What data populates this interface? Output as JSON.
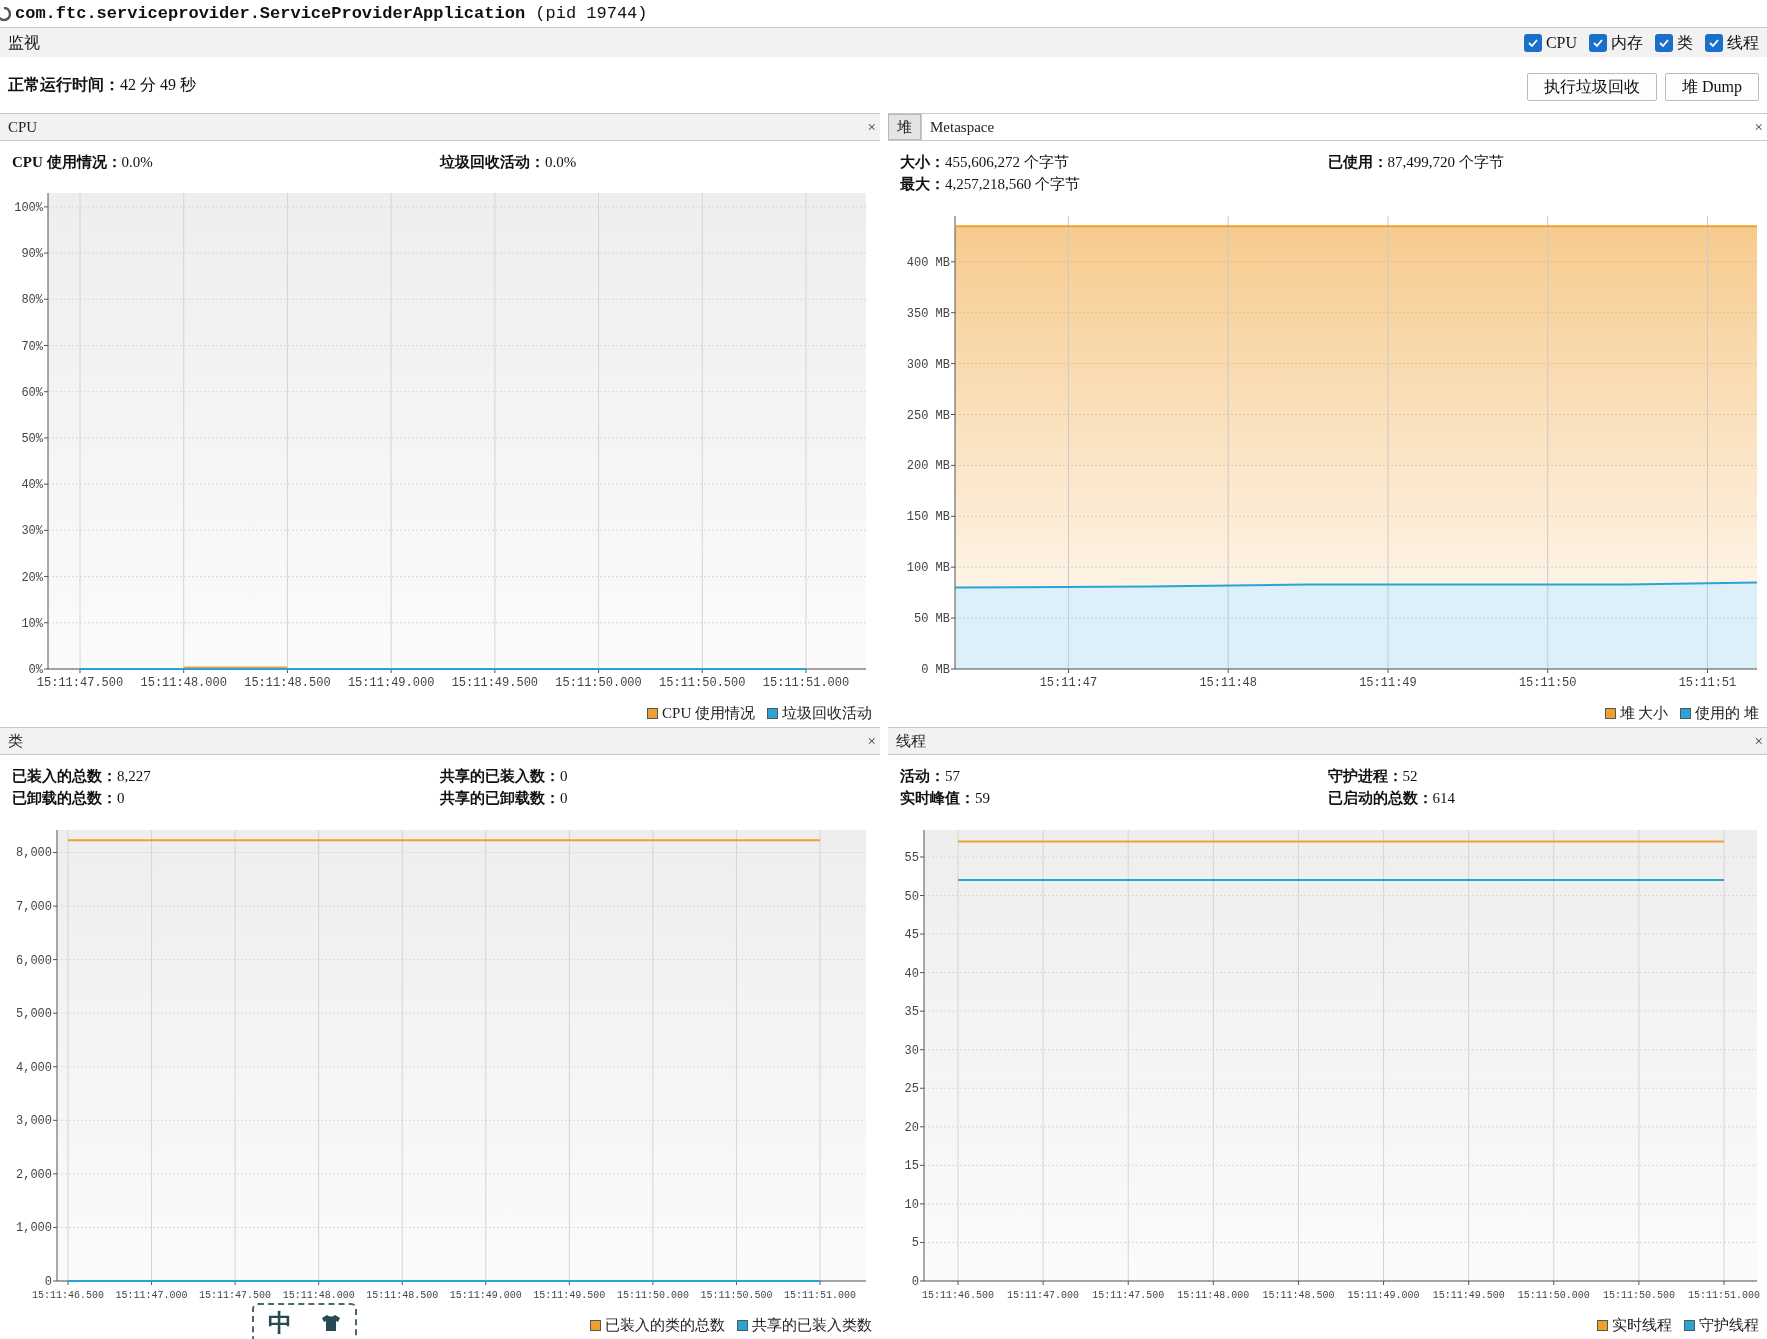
{
  "window": {
    "title": "**com.ftc.serviceprovider.ServiceProviderApplication** (pid 19744)"
  },
  "section": {
    "title": "监视",
    "toggles": [
      {
        "label": "CPU",
        "checked": true
      },
      {
        "label": "内存",
        "checked": true
      },
      {
        "label": "类",
        "checked": true
      },
      {
        "label": "线程",
        "checked": true
      }
    ]
  },
  "uptime": "**正常运行时间：**42 分 49 秒",
  "buttons": [
    "执行垃圾回收",
    "堆 Dump"
  ],
  "panels": [
    {
      "title": "CPU",
      "close": "×",
      "stats": [
        "**CPU 使用情况：**0.0%",
        "**垃圾回收活动：**0.0%"
      ],
      "chart_data": {
        "type": "line",
        "grid": true,
        "ylim": [
          0,
          103
        ],
        "categories": [
          "15:11:47.500",
          "15:11:48.000",
          "15:11:48.500",
          "15:11:49.000",
          "15:11:49.500",
          "15:11:50.000",
          "15:11:50.500",
          "15:11:51.000"
        ],
        "yticks": [
          {
            "value": 0,
            "label": "0%"
          },
          {
            "value": 10,
            "label": "10%"
          },
          {
            "value": 20,
            "label": "20%"
          },
          {
            "value": 30,
            "label": "30%"
          },
          {
            "value": 40,
            "label": "40%"
          },
          {
            "value": 50,
            "label": "50%"
          },
          {
            "value": 60,
            "label": "60%"
          },
          {
            "value": 70,
            "label": "70%"
          },
          {
            "value": 80,
            "label": "80%"
          },
          {
            "value": 90,
            "label": "90%"
          },
          {
            "value": 100,
            "label": "100%"
          }
        ],
        "series": [
          {
            "name": "CPU 使用情况",
            "color": "#f0a030",
            "values": [
              null,
              0.3,
              0.3,
              null,
              null,
              null,
              null,
              null
            ]
          },
          {
            "name": "垃圾回收活动",
            "color": "#2aa4d4",
            "values": [
              0,
              0,
              0,
              0,
              0,
              0,
              0,
              0
            ]
          }
        ]
      }
    },
    {
      "tabs": [
        {
          "label": "堆",
          "selected": true
        },
        {
          "label": "Metaspace",
          "selected": false
        }
      ],
      "close": "×",
      "stats": [
        "**大小：**455,606,272 个字节",
        "**已使用：**87,499,720 个字节",
        "**最大：**4,257,218,560 个字节"
      ],
      "chart_data": {
        "type": "area",
        "grid": true,
        "x": [
          54706.29,
          54707.5,
          54708.5,
          54709.5,
          54710.5,
          54711.31
        ],
        "xlim": [
          54706.29,
          54711.31
        ],
        "ylim": [
          0,
          445
        ],
        "xticks": [
          {
            "value": 54707,
            "label": "15:11:47"
          },
          {
            "value": 54708,
            "label": "15:11:48"
          },
          {
            "value": 54709,
            "label": "15:11:49"
          },
          {
            "value": 54710,
            "label": "15:11:50"
          },
          {
            "value": 54711,
            "label": "15:11:51"
          }
        ],
        "yticks": [
          {
            "value": 0,
            "label": "0 MB"
          },
          {
            "value": 50,
            "label": "50 MB"
          },
          {
            "value": 100,
            "label": "100 MB"
          },
          {
            "value": 150,
            "label": "150 MB"
          },
          {
            "value": 200,
            "label": "200 MB"
          },
          {
            "value": 250,
            "label": "250 MB"
          },
          {
            "value": 300,
            "label": "300 MB"
          },
          {
            "value": 350,
            "label": "350 MB"
          },
          {
            "value": 400,
            "label": "400 MB"
          }
        ],
        "series": [
          {
            "name": "堆 大小",
            "type": "area",
            "color": "#f0a030",
            "values": [
              435,
              435,
              435,
              435,
              435,
              435
            ]
          },
          {
            "name": "使用的 堆",
            "type": "area",
            "color": "#2aa4d4",
            "values": [
              80,
              81,
              83,
              83,
              83,
              85
            ]
          }
        ]
      }
    },
    {
      "title": "类",
      "close": "×",
      "stats": [
        "**已装入的总数：**8,227",
        "**共享的已装入数：**0",
        "**已卸载的总数：**0",
        "**共享的已卸载数：**0"
      ],
      "chart_data": {
        "type": "line",
        "grid": true,
        "ylim": [
          0,
          8420
        ],
        "categories": [
          "15:11:46.500",
          "15:11:47.000",
          "15:11:47.500",
          "15:11:48.000",
          "15:11:48.500",
          "15:11:49.000",
          "15:11:49.500",
          "15:11:50.000",
          "15:11:50.500",
          "15:11:51.000"
        ],
        "yticks": [
          {
            "value": 0,
            "label": "0"
          },
          {
            "value": 1000,
            "label": "1,000"
          },
          {
            "value": 2000,
            "label": "2,000"
          },
          {
            "value": 3000,
            "label": "3,000"
          },
          {
            "value": 4000,
            "label": "4,000"
          },
          {
            "value": 5000,
            "label": "5,000"
          },
          {
            "value": 6000,
            "label": "6,000"
          },
          {
            "value": 7000,
            "label": "7,000"
          },
          {
            "value": 8000,
            "label": "8,000"
          }
        ],
        "series": [
          {
            "name": "已装入的类的总数",
            "color": "#f0a030",
            "values": [
              8230,
              8230,
              8230,
              8230,
              8230,
              8230,
              8230,
              8230,
              8230,
              8230
            ]
          },
          {
            "name": "共享的已装入类数",
            "color": "#2aa4d4",
            "values": [
              0,
              0,
              0,
              0,
              0,
              0,
              0,
              0,
              0,
              0
            ]
          }
        ]
      }
    },
    {
      "title": "线程",
      "close": "×",
      "stats": [
        "**活动：**57",
        "**守护进程：**52",
        "**实时峰值：**59",
        "**已启动的总数：**614"
      ],
      "chart_data": {
        "type": "line",
        "grid": true,
        "ylim": [
          0,
          58.5
        ],
        "categories": [
          "15:11:46.500",
          "15:11:47.000",
          "15:11:47.500",
          "15:11:48.000",
          "15:11:48.500",
          "15:11:49.000",
          "15:11:49.500",
          "15:11:50.000",
          "15:11:50.500",
          "15:11:51.000"
        ],
        "yticks": [
          {
            "value": 0,
            "label": "0"
          },
          {
            "value": 5,
            "label": "5"
          },
          {
            "value": 10,
            "label": "10"
          },
          {
            "value": 15,
            "label": "15"
          },
          {
            "value": 20,
            "label": "20"
          },
          {
            "value": 25,
            "label": "25"
          },
          {
            "value": 30,
            "label": "30"
          },
          {
            "value": 35,
            "label": "35"
          },
          {
            "value": 40,
            "label": "40"
          },
          {
            "value": 45,
            "label": "45"
          },
          {
            "value": 50,
            "label": "50"
          },
          {
            "value": 55,
            "label": "55"
          }
        ],
        "series": [
          {
            "name": "实时线程",
            "color": "#f0a030",
            "values": [
              57,
              57,
              57,
              57,
              57,
              57,
              57,
              57,
              57,
              57
            ]
          },
          {
            "name": "守护线程",
            "color": "#2aa4d4",
            "values": [
              52,
              52,
              52,
              52,
              52,
              52,
              52,
              52,
              52,
              52
            ]
          }
        ]
      }
    }
  ],
  "ime_toolbar": {
    "label": "中"
  }
}
